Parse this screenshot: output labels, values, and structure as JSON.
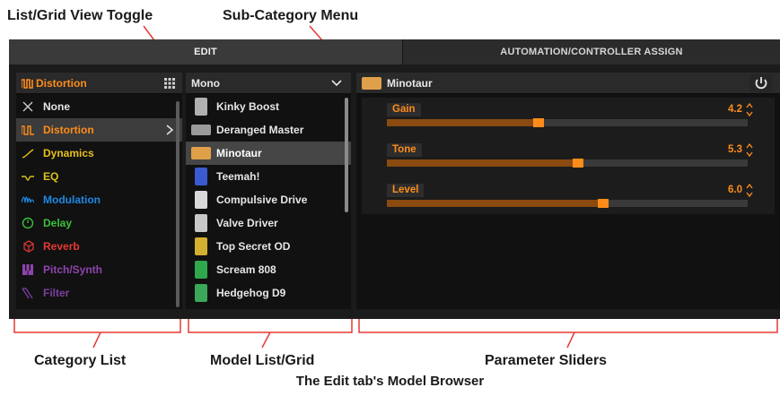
{
  "callouts": {
    "list_grid_toggle": "List/Grid View Toggle",
    "sub_category_menu": "Sub-Category Menu",
    "category_list": "Category List",
    "model_list_grid": "Model List/Grid",
    "parameter_sliders": "Parameter Sliders",
    "caption": "The Edit tab's Model Browser"
  },
  "tabs": {
    "edit": "EDIT",
    "automation": "AUTOMATION/CONTROLLER ASSIGN"
  },
  "category_panel": {
    "title": "Distortion",
    "title_color": "#ff8c1a",
    "items": [
      {
        "label": "None",
        "color": "#e6e6e6",
        "icon": "x-icon"
      },
      {
        "label": "Distortion",
        "color": "#ff8c1a",
        "icon": "distortion-wave-icon",
        "selected": true
      },
      {
        "label": "Dynamics",
        "color": "#e8c01a",
        "icon": "dynamics-curve-icon"
      },
      {
        "label": "EQ",
        "color": "#d9c21c",
        "icon": "eq-wave-icon"
      },
      {
        "label": "Modulation",
        "color": "#1e88e5",
        "icon": "modulation-wave-icon"
      },
      {
        "label": "Delay",
        "color": "#3bbf3b",
        "icon": "delay-circle-icon"
      },
      {
        "label": "Reverb",
        "color": "#e53935",
        "icon": "reverb-cube-icon"
      },
      {
        "label": "Pitch/Synth",
        "color": "#8e44ad",
        "icon": "piano-keys-icon"
      },
      {
        "label": "Filter",
        "color": "#7b3fa0",
        "icon": "filter-slope-icon"
      }
    ]
  },
  "model_panel": {
    "subcategory": "Mono",
    "items": [
      {
        "label": "Kinky Boost",
        "pedal_color": "#b0b0b0",
        "icon": "kinky-boost-pedal-icon"
      },
      {
        "label": "Deranged Master",
        "pedal_color": "#9a9a9a",
        "icon": "deranged-master-pedal-icon"
      },
      {
        "label": "Minotaur",
        "pedal_color": "#e0a04a",
        "icon": "minotaur-pedal-icon",
        "selected": true
      },
      {
        "label": "Teemah!",
        "pedal_color": "#3a5ad0",
        "icon": "teemah-pedal-icon"
      },
      {
        "label": "Compulsive Drive",
        "pedal_color": "#d9d9d9",
        "icon": "compulsive-drive-pedal-icon"
      },
      {
        "label": "Valve Driver",
        "pedal_color": "#c8c8c8",
        "icon": "valve-driver-pedal-icon"
      },
      {
        "label": "Top Secret OD",
        "pedal_color": "#d4b030",
        "icon": "top-secret-od-pedal-icon"
      },
      {
        "label": "Scream 808",
        "pedal_color": "#2ea84a",
        "icon": "scream-808-pedal-icon"
      },
      {
        "label": "Hedgehog D9",
        "pedal_color": "#3aa858",
        "icon": "hedgehog-d9-pedal-icon"
      }
    ]
  },
  "param_panel": {
    "title": "Minotaur",
    "title_icon": "minotaur-pedal-icon",
    "params": [
      {
        "name": "Gain",
        "value": "4.2",
        "level": 0.42
      },
      {
        "name": "Tone",
        "value": "5.3",
        "level": 0.53
      },
      {
        "name": "Level",
        "value": "6.0",
        "level": 0.6
      }
    ]
  },
  "colors": {
    "accent": "#ff8c1a",
    "callout_line": "#e53935"
  }
}
